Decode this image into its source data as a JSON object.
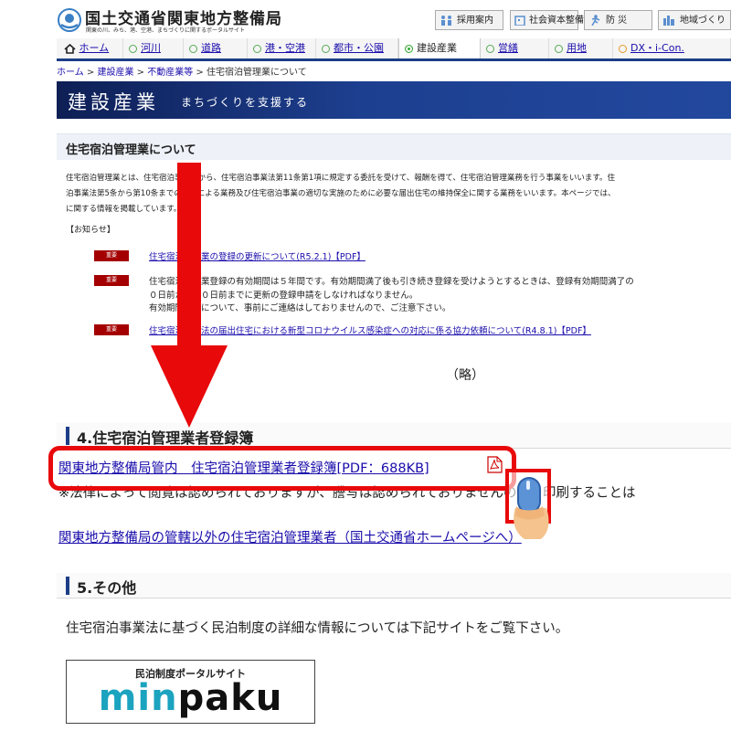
{
  "header": {
    "site_title": "国土交通省関東地方整備局",
    "site_subtitle": "関東の川、みち、港、空港、まちづくりに関するポータルサイト",
    "utility_links": [
      {
        "label": "採用案内",
        "icon": "people-icon"
      },
      {
        "label": "社会資本整備",
        "icon": "building-icon"
      },
      {
        "label": "防 災",
        "icon": "runner-icon"
      },
      {
        "label": "地域づくり",
        "icon": "city-icon"
      }
    ]
  },
  "nav": {
    "tabs": [
      {
        "label": "ホーム",
        "icon": "home-icon",
        "link": true
      },
      {
        "label": "河川",
        "link": true
      },
      {
        "label": "道路",
        "link": true
      },
      {
        "label": "港・空港",
        "link": true
      },
      {
        "label": "都市・公園",
        "link": true
      },
      {
        "label": "建設産業",
        "link": false,
        "active": true
      },
      {
        "label": "営繕",
        "link": true
      },
      {
        "label": "用地",
        "link": true
      },
      {
        "label": "DX・i-Con.",
        "link": true
      }
    ]
  },
  "breadcrumb": {
    "items": [
      "ホーム",
      "建設産業",
      "不動産業等"
    ],
    "separator": ">",
    "current": "住宅宿泊管理業について"
  },
  "banner": {
    "title": "建設産業",
    "subtitle": "まちづくりを支援する"
  },
  "article": {
    "title": "住宅宿泊管理業について",
    "intro_lines": [
      "住宅宿泊管理業とは、住宅宿泊事業者から、住宅宿泊事業法第11条第1項に規定する委託を受けて、報酬を得て、住宅宿泊管理業務を行う事業をいいます。住",
      "泊事業法第5条から第10条までの規定による業務及び住宅宿泊事業の適切な実施のために必要な届出住宅の維持保全に関する業務をいいます。本ページでは、",
      "に関する情報を掲載しています。"
    ],
    "notice_label": "【お知らせ】",
    "notices": [
      {
        "badge": "重要",
        "link": "住宅宿泊管理業の登録の更新について(R5.2.1)【PDF】"
      },
      {
        "badge": "重要",
        "lines": [
          "住宅宿泊管理業登録の有効期間は５年間です。有効期間満了後も引き続き登録を受けようとするときは、登録有効期間満了の",
          "０日前から３０日前までに更新の登録申請をしなければなりません。",
          "有効期間満了について、事前にご連絡はしておりませんので、ご注意下さい。"
        ]
      },
      {
        "badge": "重要",
        "link": "住宅宿泊事業法の届出住宅における新型コロナウイルス感染症への対応に係る協力依頼について(R4.8.1)【PDF】"
      }
    ]
  },
  "omitted_note": "（略）",
  "section4": {
    "heading": "4.住宅宿泊管理業者登録簿",
    "pdf_link": "関東地方整備局管内　住宅宿泊管理業者登録簿[PDF：688KB]",
    "pdf_icon": "pdf-icon",
    "note": "※法律によって閲覧は認められておりますが、謄写は認められておりませんので、印刷することは",
    "mlit_link": "関東地方整備局の管轄以外の住宅宿泊管理業者（国土交通省ホームページへ）"
  },
  "section5": {
    "heading": "5.その他",
    "text": "住宅宿泊事業法に基づく民泊制度の詳細な情報については下記サイトをご覧下さい。",
    "banner_caption": "民泊制度ポータルサイト",
    "banner_word_parts": [
      "m",
      "i",
      "n",
      "p",
      "a",
      "k",
      "u"
    ]
  },
  "overlay": {
    "arrow_icon": "down-arrow-icon",
    "cursor_icon": "mouse-click-hand-icon",
    "colors": {
      "highlight": "#e8090b",
      "nav_blue": "#1d3e86",
      "badge_red": "#a40000",
      "minpaku_cyan": "#1ba3bf"
    }
  }
}
